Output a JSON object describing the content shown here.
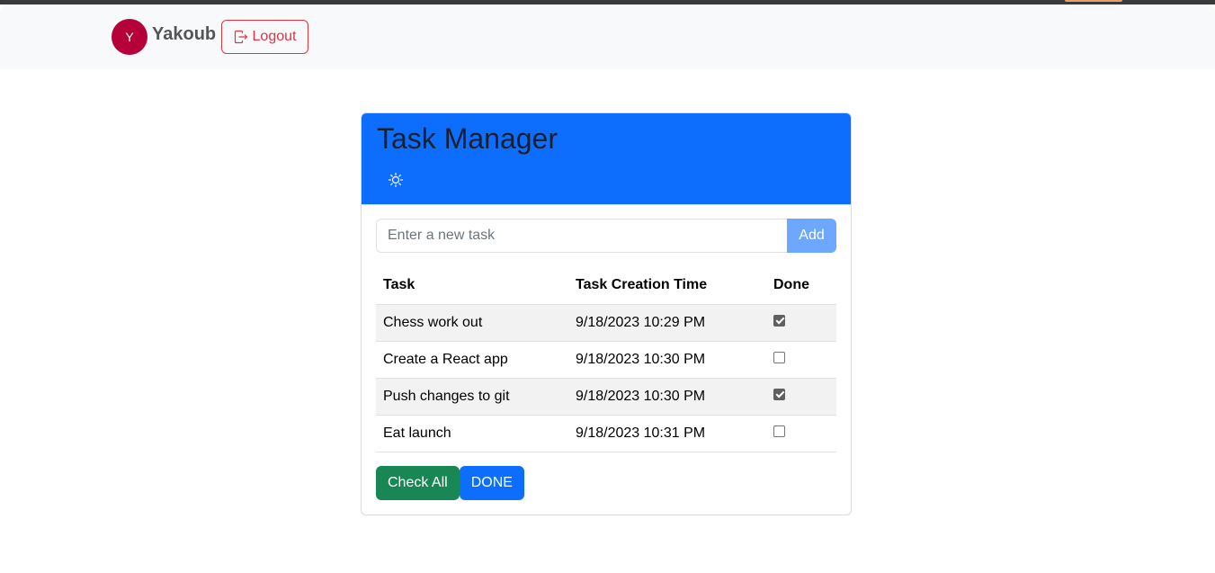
{
  "navbar": {
    "avatar_initial": "Y",
    "username": "Yakoub",
    "logout_label": "Logout"
  },
  "card": {
    "title": "Task Manager",
    "theme_icon": "sun-icon"
  },
  "form": {
    "placeholder": "Enter a new task",
    "value": "",
    "add_label": "Add"
  },
  "table": {
    "headers": [
      "Task",
      "Task Creation Time",
      "Done"
    ],
    "rows": [
      {
        "task": "Chess work out",
        "time": "9/18/2023 10:29 PM",
        "done": true
      },
      {
        "task": "Create a React app",
        "time": "9/18/2023 10:30 PM",
        "done": false
      },
      {
        "task": "Push changes to git",
        "time": "9/18/2023 10:30 PM",
        "done": true
      },
      {
        "task": "Eat launch",
        "time": "9/18/2023 10:31 PM",
        "done": false
      }
    ]
  },
  "actions": {
    "check_all_label": "Check All",
    "done_label": "DONE"
  },
  "colors": {
    "primary": "#0d6efd",
    "success": "#198754",
    "danger": "#dc3545",
    "avatar": "#b5003a",
    "add_disabled": "#6ea8fe"
  }
}
